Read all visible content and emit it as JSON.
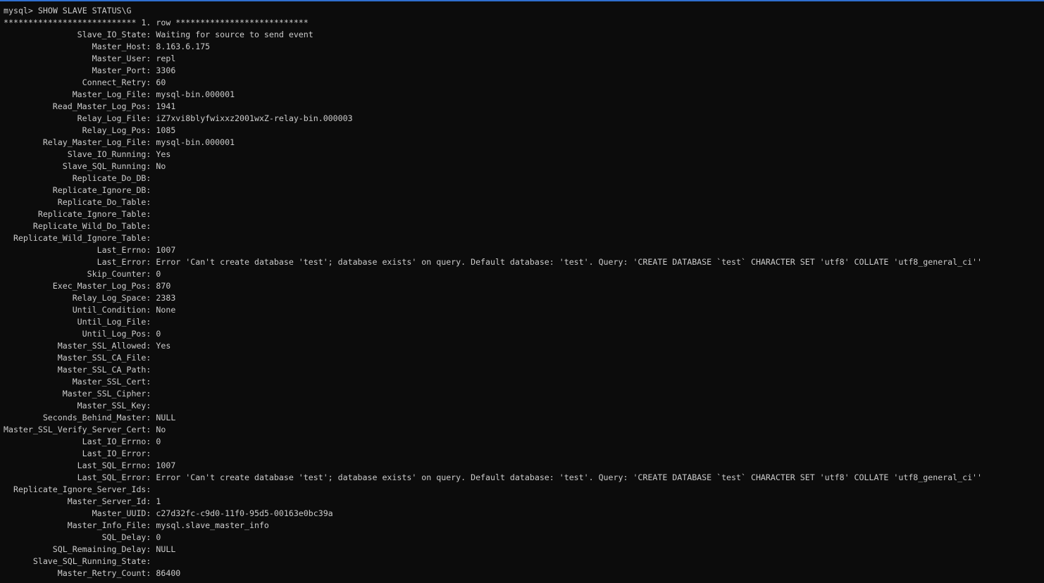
{
  "terminal": {
    "prompt": "mysql> ",
    "command": "SHOW SLAVE STATUS\\G",
    "row_header": "*************************** 1. row ***************************",
    "rows": [
      {
        "key": "Slave_IO_State",
        "value": "Waiting for source to send event"
      },
      {
        "key": "Master_Host",
        "value": "8.163.6.175"
      },
      {
        "key": "Master_User",
        "value": "repl"
      },
      {
        "key": "Master_Port",
        "value": "3306"
      },
      {
        "key": "Connect_Retry",
        "value": "60"
      },
      {
        "key": "Master_Log_File",
        "value": "mysql-bin.000001"
      },
      {
        "key": "Read_Master_Log_Pos",
        "value": "1941"
      },
      {
        "key": "Relay_Log_File",
        "value": "iZ7xvi8blyfwixxz2001wxZ-relay-bin.000003"
      },
      {
        "key": "Relay_Log_Pos",
        "value": "1085"
      },
      {
        "key": "Relay_Master_Log_File",
        "value": "mysql-bin.000001"
      },
      {
        "key": "Slave_IO_Running",
        "value": "Yes"
      },
      {
        "key": "Slave_SQL_Running",
        "value": "No"
      },
      {
        "key": "Replicate_Do_DB",
        "value": ""
      },
      {
        "key": "Replicate_Ignore_DB",
        "value": ""
      },
      {
        "key": "Replicate_Do_Table",
        "value": ""
      },
      {
        "key": "Replicate_Ignore_Table",
        "value": ""
      },
      {
        "key": "Replicate_Wild_Do_Table",
        "value": ""
      },
      {
        "key": "Replicate_Wild_Ignore_Table",
        "value": ""
      },
      {
        "key": "Last_Errno",
        "value": "1007"
      },
      {
        "key": "Last_Error",
        "value": "Error 'Can't create database 'test'; database exists' on query. Default database: 'test'. Query: 'CREATE DATABASE `test` CHARACTER SET 'utf8' COLLATE 'utf8_general_ci''"
      },
      {
        "key": "Skip_Counter",
        "value": "0"
      },
      {
        "key": "Exec_Master_Log_Pos",
        "value": "870"
      },
      {
        "key": "Relay_Log_Space",
        "value": "2383"
      },
      {
        "key": "Until_Condition",
        "value": "None"
      },
      {
        "key": "Until_Log_File",
        "value": ""
      },
      {
        "key": "Until_Log_Pos",
        "value": "0"
      },
      {
        "key": "Master_SSL_Allowed",
        "value": "Yes"
      },
      {
        "key": "Master_SSL_CA_File",
        "value": ""
      },
      {
        "key": "Master_SSL_CA_Path",
        "value": ""
      },
      {
        "key": "Master_SSL_Cert",
        "value": ""
      },
      {
        "key": "Master_SSL_Cipher",
        "value": ""
      },
      {
        "key": "Master_SSL_Key",
        "value": ""
      },
      {
        "key": "Seconds_Behind_Master",
        "value": "NULL"
      },
      {
        "key": "Master_SSL_Verify_Server_Cert",
        "value": "No"
      },
      {
        "key": "Last_IO_Errno",
        "value": "0"
      },
      {
        "key": "Last_IO_Error",
        "value": ""
      },
      {
        "key": "Last_SQL_Errno",
        "value": "1007"
      },
      {
        "key": "Last_SQL_Error",
        "value": "Error 'Can't create database 'test'; database exists' on query. Default database: 'test'. Query: 'CREATE DATABASE `test` CHARACTER SET 'utf8' COLLATE 'utf8_general_ci''"
      },
      {
        "key": "Replicate_Ignore_Server_Ids",
        "value": ""
      },
      {
        "key": "Master_Server_Id",
        "value": "1"
      },
      {
        "key": "Master_UUID",
        "value": "c27d32fc-c9d0-11f0-95d5-00163e0bc39a"
      },
      {
        "key": "Master_Info_File",
        "value": "mysql.slave_master_info"
      },
      {
        "key": "SQL_Delay",
        "value": "0"
      },
      {
        "key": "SQL_Remaining_Delay",
        "value": "NULL"
      },
      {
        "key": "Slave_SQL_Running_State",
        "value": ""
      },
      {
        "key": "Master_Retry_Count",
        "value": "86400"
      }
    ]
  },
  "colors": {
    "background": "#0c0c0c",
    "text": "#cccccc",
    "accent": "#2f6fd0"
  }
}
